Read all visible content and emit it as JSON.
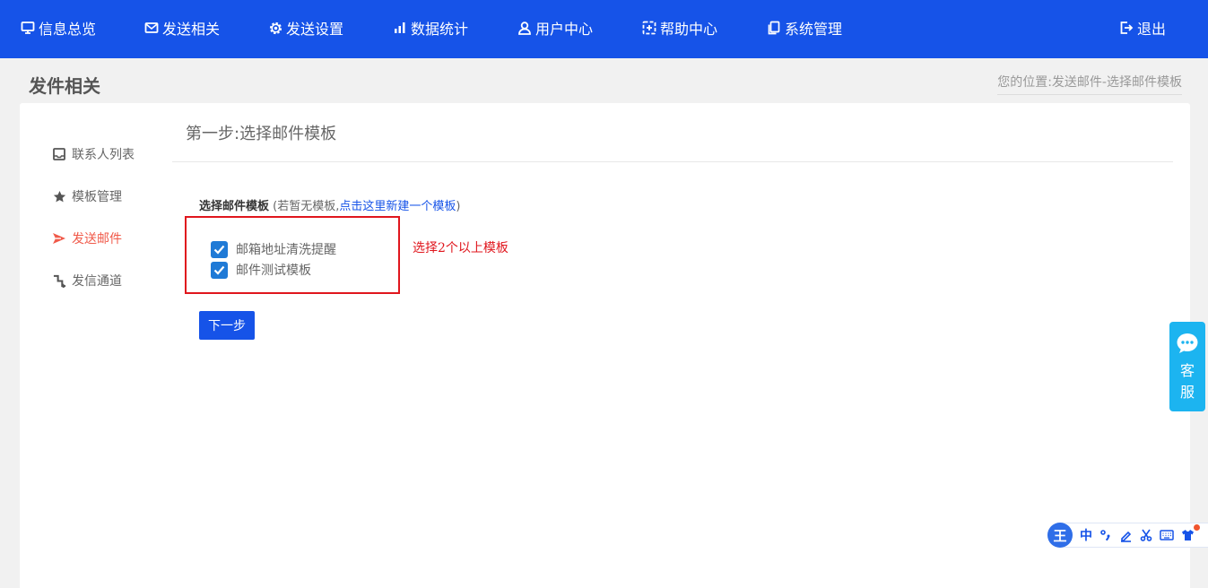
{
  "nav": {
    "items": [
      {
        "label": "信息总览",
        "icon": "monitor-icon"
      },
      {
        "label": "发送相关",
        "icon": "mail-icon"
      },
      {
        "label": "发送设置",
        "icon": "gear-icon"
      },
      {
        "label": "数据统计",
        "icon": "bar-chart-icon"
      },
      {
        "label": "用户中心",
        "icon": "user-icon"
      },
      {
        "label": "帮助中心",
        "icon": "help-icon"
      },
      {
        "label": "系统管理",
        "icon": "copy-icon"
      }
    ],
    "logout_label": "退出",
    "color": "#1653e8"
  },
  "page": {
    "title": "发件相关",
    "breadcrumb": "您的位置:发送邮件-选择邮件模板"
  },
  "sidebar": {
    "items": [
      {
        "label": "联系人列表",
        "icon": "inbox-icon",
        "active": false
      },
      {
        "label": "模板管理",
        "icon": "star-icon",
        "active": false
      },
      {
        "label": "发送邮件",
        "icon": "send-icon",
        "active": true
      },
      {
        "label": "发信通道",
        "icon": "channel-icon",
        "active": false
      }
    ],
    "active_color": "#f05a4a"
  },
  "main": {
    "step_title": "第一步:选择邮件模板",
    "template_label": "选择邮件模板",
    "hint_prefix": " (若暂无模板,",
    "hint_link": "点击这里新建一个模板",
    "hint_suffix": ")",
    "templates": [
      {
        "label": "邮箱地址清洗提醒",
        "checked": true
      },
      {
        "label": "邮件测试模板",
        "checked": true
      }
    ],
    "annotation": "选择2个以上模板",
    "next_label": "下一步"
  },
  "kefu": {
    "label_line1": "客",
    "label_line2": "服",
    "icon": "chat-bubble-icon"
  },
  "ime": {
    "logo": "王",
    "lang": "中",
    "buttons": [
      "punctuation-icon",
      "pen-icon",
      "scissors-icon",
      "keyboard-icon",
      "shirt-icon"
    ]
  }
}
